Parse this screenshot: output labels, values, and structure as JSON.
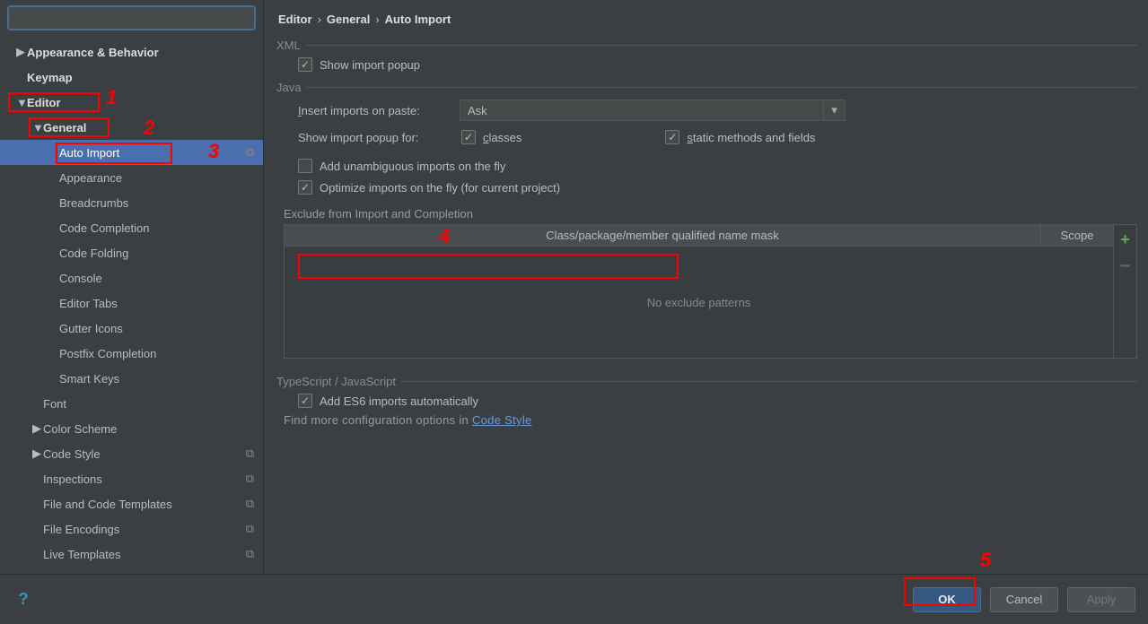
{
  "search": {
    "placeholder": ""
  },
  "sidebar": {
    "items": [
      {
        "label": "Appearance & Behavior",
        "level": 0,
        "arrow": "▶",
        "bold": true
      },
      {
        "label": "Keymap",
        "level": 0,
        "arrow": "",
        "bold": true
      },
      {
        "label": "Editor",
        "level": 0,
        "arrow": "▼",
        "bold": true
      },
      {
        "label": "General",
        "level": 1,
        "arrow": "▼",
        "bold": true
      },
      {
        "label": "Auto Import",
        "level": 2,
        "arrow": "",
        "selected": true,
        "badge": "⧉"
      },
      {
        "label": "Appearance",
        "level": 2,
        "arrow": ""
      },
      {
        "label": "Breadcrumbs",
        "level": 2,
        "arrow": ""
      },
      {
        "label": "Code Completion",
        "level": 2,
        "arrow": ""
      },
      {
        "label": "Code Folding",
        "level": 2,
        "arrow": ""
      },
      {
        "label": "Console",
        "level": 2,
        "arrow": ""
      },
      {
        "label": "Editor Tabs",
        "level": 2,
        "arrow": ""
      },
      {
        "label": "Gutter Icons",
        "level": 2,
        "arrow": ""
      },
      {
        "label": "Postfix Completion",
        "level": 2,
        "arrow": ""
      },
      {
        "label": "Smart Keys",
        "level": 2,
        "arrow": ""
      },
      {
        "label": "Font",
        "level": 1,
        "arrow": ""
      },
      {
        "label": "Color Scheme",
        "level": 1,
        "arrow": "▶"
      },
      {
        "label": "Code Style",
        "level": 1,
        "arrow": "▶",
        "badge": "⧉"
      },
      {
        "label": "Inspections",
        "level": 1,
        "arrow": "",
        "badge": "⧉"
      },
      {
        "label": "File and Code Templates",
        "level": 1,
        "arrow": "",
        "badge": "⧉"
      },
      {
        "label": "File Encodings",
        "level": 1,
        "arrow": "",
        "badge": "⧉"
      },
      {
        "label": "Live Templates",
        "level": 1,
        "arrow": "",
        "badge": "⧉"
      }
    ]
  },
  "breadcrumbs": [
    "Editor",
    "General",
    "Auto Import"
  ],
  "xml": {
    "title": "XML",
    "show_popup": "Show import popup"
  },
  "java": {
    "title": "Java",
    "insert_label": "Insert imports on paste:",
    "insert_value": "Ask",
    "show_popup_label": "Show import popup for:",
    "classes": "classes",
    "static": "static methods and fields",
    "unambiguous": "Add unambiguous imports on the fly",
    "optimize": "Optimize imports on the fly (for current project)",
    "exclude_title": "Exclude from Import and Completion",
    "th1": "Class/package/member qualified name mask",
    "th2": "Scope",
    "empty": "No exclude patterns"
  },
  "ts": {
    "title": "TypeScript / JavaScript",
    "es6": "Add ES6 imports automatically",
    "note_prefix": "Find more configuration options in ",
    "note_link": "Code Style"
  },
  "buttons": {
    "ok": "OK",
    "cancel": "Cancel",
    "apply": "Apply"
  },
  "annotations": {
    "n1": "1",
    "n2": "2",
    "n3": "3",
    "n4": "4",
    "n5": "5"
  }
}
